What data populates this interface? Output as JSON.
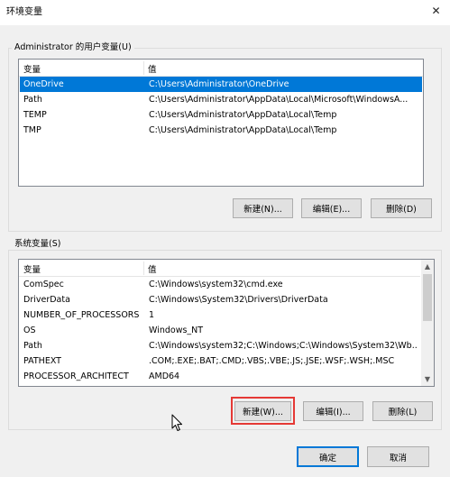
{
  "window": {
    "title": "环境变量",
    "close_glyph": "✕"
  },
  "user_vars": {
    "group_label": "Administrator 的用户变量(U)",
    "columns": {
      "name": "变量",
      "value": "值"
    },
    "rows": [
      {
        "name": "OneDrive",
        "value": "C:\\Users\\Administrator\\OneDrive",
        "selected": true
      },
      {
        "name": "Path",
        "value": "C:\\Users\\Administrator\\AppData\\Local\\Microsoft\\WindowsA...",
        "selected": false
      },
      {
        "name": "TEMP",
        "value": "C:\\Users\\Administrator\\AppData\\Local\\Temp",
        "selected": false
      },
      {
        "name": "TMP",
        "value": "C:\\Users\\Administrator\\AppData\\Local\\Temp",
        "selected": false
      }
    ],
    "buttons": {
      "new": "新建(N)...",
      "edit": "编辑(E)...",
      "delete": "删除(D)"
    }
  },
  "system_vars": {
    "group_label": "系统变量(S)",
    "columns": {
      "name": "变量",
      "value": "值"
    },
    "rows": [
      {
        "name": "ComSpec",
        "value": "C:\\Windows\\system32\\cmd.exe"
      },
      {
        "name": "DriverData",
        "value": "C:\\Windows\\System32\\Drivers\\DriverData"
      },
      {
        "name": "NUMBER_OF_PROCESSORS",
        "value": "1"
      },
      {
        "name": "OS",
        "value": "Windows_NT"
      },
      {
        "name": "Path",
        "value": "C:\\Windows\\system32;C:\\Windows;C:\\Windows\\System32\\Wb..."
      },
      {
        "name": "PATHEXT",
        "value": ".COM;.EXE;.BAT;.CMD;.VBS;.VBE;.JS;.JSE;.WSF;.WSH;.MSC"
      },
      {
        "name": "PROCESSOR_ARCHITECT",
        "value": "AMD64"
      }
    ],
    "buttons": {
      "new": "新建(W)...",
      "edit": "编辑(I)...",
      "delete": "删除(L)"
    }
  },
  "footer": {
    "ok": "确定",
    "cancel": "取消"
  },
  "colors": {
    "selection": "#0078d7",
    "highlight_box": "#e53935",
    "default_button_border": "#0078d7"
  },
  "icons": {
    "scroll_up": "▲",
    "scroll_down": "▼",
    "cursor": "arrow-cursor-icon"
  }
}
